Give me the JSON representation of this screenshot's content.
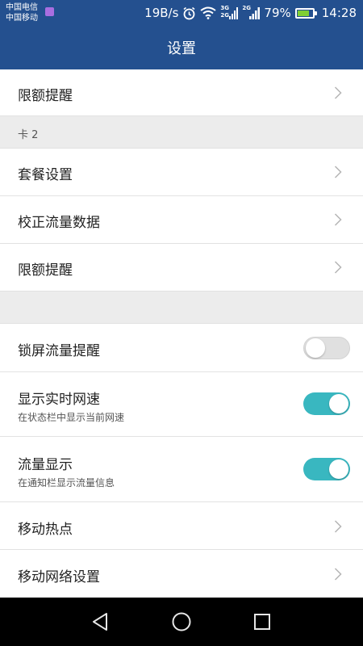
{
  "status_bar": {
    "carrier_1": "中国电信",
    "carrier_2": "中国移动",
    "net_speed": "19B/s",
    "sig1_label_top": "3G",
    "sig1_label_bottom": "2G",
    "sig2_label": "2G",
    "battery_pct": "79%",
    "battery_level": 0.79,
    "time": "14:28",
    "icons": [
      "alarm-icon",
      "wifi-icon",
      "signal-icon",
      "battery-icon"
    ]
  },
  "header": {
    "title": "设置"
  },
  "rows": {
    "limit_reminder_1": "限额提醒",
    "card2_section": "卡 2",
    "plan_settings": "套餐设置",
    "calibrate_data": "校正流量数据",
    "limit_reminder_2": "限额提醒",
    "lock_screen_reminder": "锁屏流量提醒",
    "realtime_speed": "显示实时网速",
    "realtime_speed_sub": "在状态栏中显示当前网速",
    "traffic_display": "流量显示",
    "traffic_display_sub": "在通知栏显示流量信息",
    "mobile_hotspot": "移动热点",
    "mobile_network": "移动网络设置"
  },
  "toggles": {
    "lock_screen_reminder": false,
    "realtime_speed": true,
    "traffic_display": true
  },
  "colors": {
    "header_bg": "#24508f",
    "toggle_on": "#39b7c0",
    "battery_fill": "#7fcf34"
  }
}
